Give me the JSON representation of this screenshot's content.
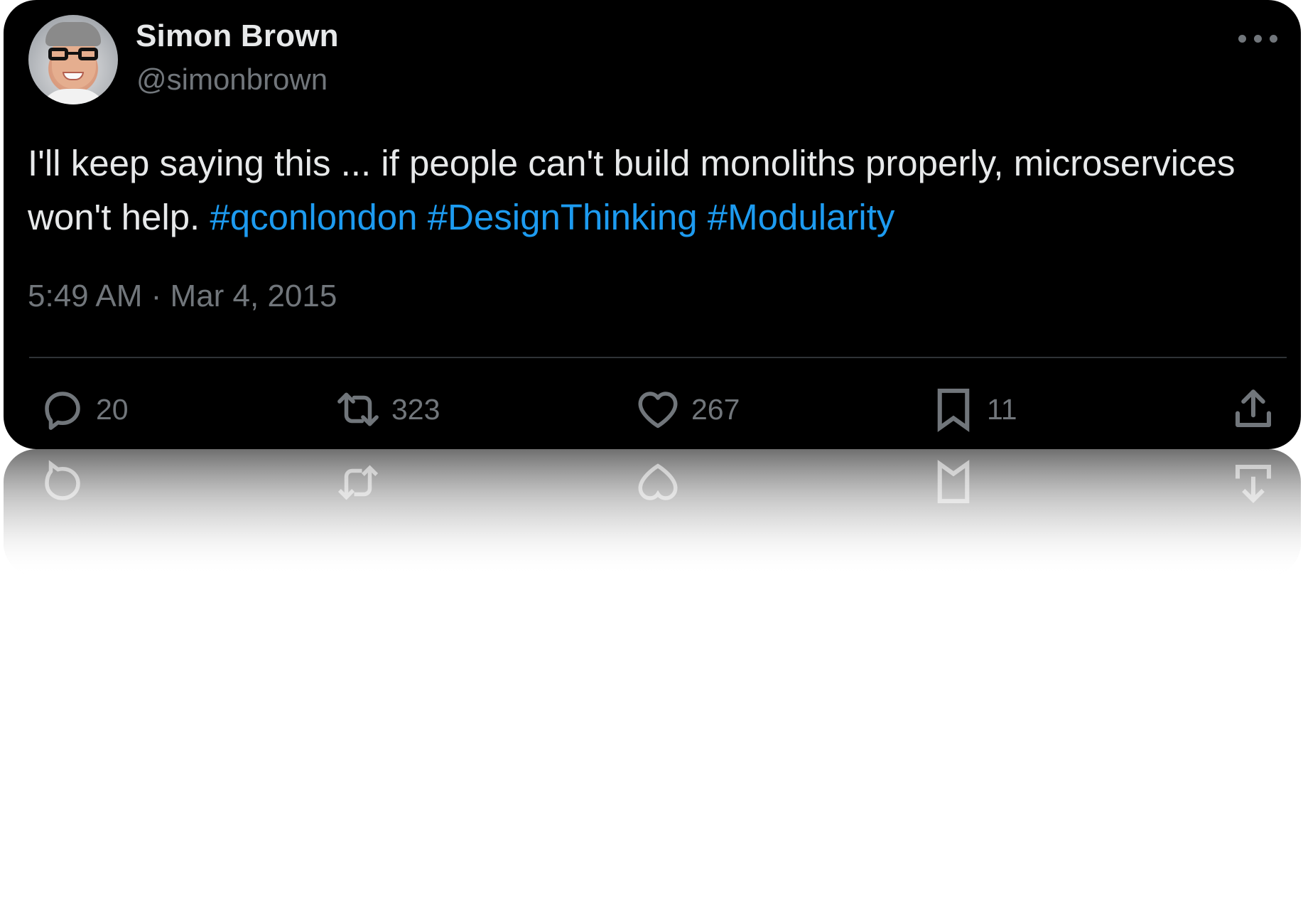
{
  "author": {
    "name": "Simon Brown",
    "handle": "@simonbrown",
    "avatar_icon": "user-avatar-photo"
  },
  "tweet": {
    "text": "I'll keep saying this ... if people can't build monoliths properly, microservices won't help.",
    "hashtags": [
      "#qconlondon",
      "#DesignThinking",
      "#Modularity"
    ],
    "timestamp": "5:49 AM · Mar 4, 2015"
  },
  "actions": {
    "reply": {
      "icon": "reply-icon",
      "count": "20"
    },
    "retweet": {
      "icon": "retweet-icon",
      "count": "323"
    },
    "like": {
      "icon": "heart-icon",
      "count": "267"
    },
    "bookmark": {
      "icon": "bookmark-icon",
      "count": "11"
    },
    "share": {
      "icon": "share-icon"
    }
  },
  "menu": {
    "icon": "more-options-icon"
  },
  "colors": {
    "background": "#000000",
    "text": "#e7e9ea",
    "secondary": "#71767b",
    "link": "#1d9bf0",
    "divider": "#2f3336"
  }
}
